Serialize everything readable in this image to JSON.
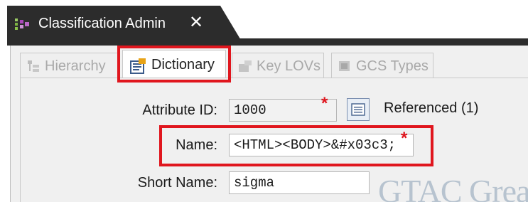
{
  "window": {
    "tab_title": "Classification Admin",
    "close_glyph": "✕"
  },
  "subtabs": [
    {
      "label": "Hierarchy",
      "icon": "hierarchy-icon",
      "state": "disabled"
    },
    {
      "label": "Dictionary",
      "icon": "dictionary-icon",
      "state": "active"
    },
    {
      "label": "Key LOVs",
      "icon": "key-lovs-icon",
      "state": "disabled"
    },
    {
      "label": "GCS Types",
      "icon": "gcs-types-icon",
      "state": "disabled"
    }
  ],
  "form": {
    "attribute_id": {
      "label": "Attribute ID:",
      "value": "1000",
      "required": "*"
    },
    "referenced_label": "Referenced (1)",
    "name": {
      "label": "Name:",
      "value": "<HTML><BODY>&#x03c3;",
      "required": "*"
    },
    "short_name": {
      "label": "Short Name:",
      "value": "sigma"
    }
  },
  "watermark": "GTAC Great",
  "colors": {
    "highlight": "#e0161e",
    "tab_bar": "#2c2c2c",
    "panel": "#f0f0f0"
  }
}
